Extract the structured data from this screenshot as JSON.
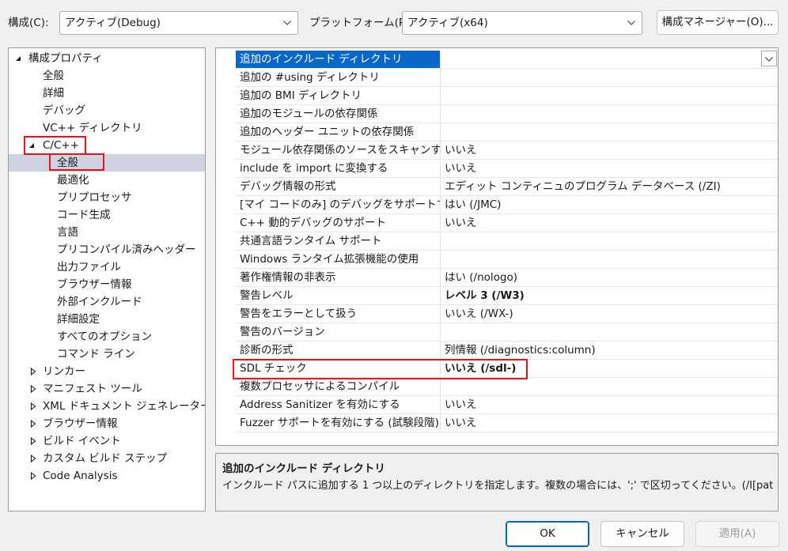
{
  "toolbar": {
    "config_label": "構成(C):",
    "config_value": "アクティブ(Debug)",
    "platform_label": "プラットフォーム(P):",
    "platform_value": "アクティブ(x64)",
    "manager_button": "構成マネージャー(O)..."
  },
  "tree": {
    "root": "構成プロパティ",
    "items": [
      "全般",
      "詳細",
      "デバッグ",
      "VC++ ディレクトリ",
      "C/C++",
      "全般",
      "最適化",
      "プリプロセッサ",
      "コード生成",
      "言語",
      "プリコンパイル済みヘッダー",
      "出力ファイル",
      "ブラウザー情報",
      "外部インクルード",
      "詳細設定",
      "すべてのオプション",
      "コマンド ライン",
      "リンカー",
      "マニフェスト ツール",
      "XML ドキュメント ジェネレーター",
      "ブラウザー情報",
      "ビルド イベント",
      "カスタム ビルド ステップ",
      "Code Analysis"
    ]
  },
  "grid": {
    "rows": [
      {
        "name": "追加のインクルード ディレクトリ",
        "value": ""
      },
      {
        "name": "追加の #using ディレクトリ",
        "value": ""
      },
      {
        "name": "追加の BMI ディレクトリ",
        "value": ""
      },
      {
        "name": "追加のモジュールの依存関係",
        "value": ""
      },
      {
        "name": "追加のヘッダー ユニットの依存関係",
        "value": ""
      },
      {
        "name": "モジュール依存関係のソースをスキャンする",
        "value": "いいえ"
      },
      {
        "name": "include を import に変換する",
        "value": "いいえ"
      },
      {
        "name": "デバッグ情報の形式",
        "value": "エディット コンティニュのプログラム データベース (/ZI)"
      },
      {
        "name": "[マイ コードのみ] のデバッグをサポートする",
        "value": "はい (/JMC)"
      },
      {
        "name": "C++ 動的デバッグのサポート",
        "value": "いいえ"
      },
      {
        "name": "共通言語ランタイム サポート",
        "value": ""
      },
      {
        "name": "Windows ランタイム拡張機能の使用",
        "value": ""
      },
      {
        "name": "著作権情報の非表示",
        "value": "はい (/nologo)"
      },
      {
        "name": "警告レベル",
        "value": "レベル 3 (/W3)"
      },
      {
        "name": "警告をエラーとして扱う",
        "value": "いいえ (/WX-)"
      },
      {
        "name": "警告のバージョン",
        "value": ""
      },
      {
        "name": "診断の形式",
        "value": "列情報 (/diagnostics:column)"
      },
      {
        "name": "SDL チェック",
        "value": "いいえ (/sdl-)"
      },
      {
        "name": "複数プロセッサによるコンパイル",
        "value": ""
      },
      {
        "name": "Address Sanitizer を有効にする",
        "value": "いいえ"
      },
      {
        "name": "Fuzzer サポートを有効にする (試験段階)",
        "value": "いいえ"
      }
    ]
  },
  "description": {
    "title": "追加のインクルード ディレクトリ",
    "text": "インクルード パスに追加する 1 つ以上のディレクトリを指定します。複数の場合には、';' で区切ってください。(/I[path])"
  },
  "buttons": {
    "ok": "OK",
    "cancel": "キャンセル",
    "apply": "適用(A)"
  },
  "colors": {
    "highlight_red": "#e8131b",
    "selection_blue": "#0a66c9",
    "tree_selection": "#cfd3e1"
  }
}
